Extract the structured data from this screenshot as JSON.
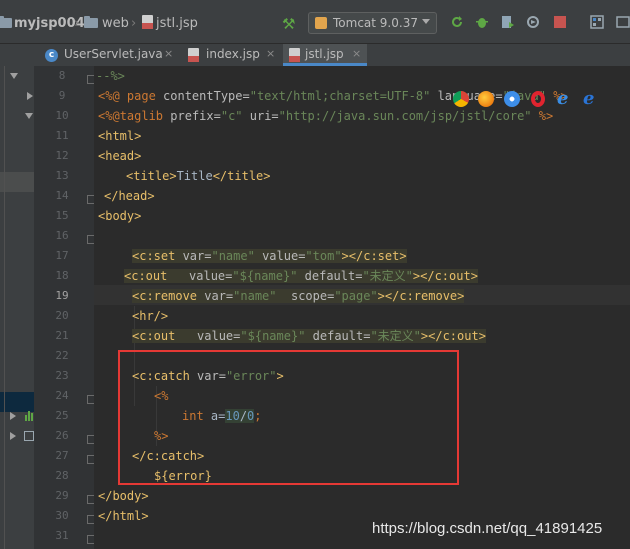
{
  "breadcrumb": {
    "project": "myjsp004",
    "folder": "web",
    "file": "jstl.jsp"
  },
  "toolbar": {
    "run_config": "Tomcat 9.0.37"
  },
  "tabs": [
    {
      "label": "UserServlet.java",
      "close": "×"
    },
    {
      "label": "index.jsp",
      "close": "×"
    },
    {
      "label": "jstl.jsp",
      "close": "×"
    }
  ],
  "editor": {
    "current_line": "19",
    "line_numbers": [
      "8",
      "9",
      "10",
      "11",
      "12",
      "13",
      "14",
      "15",
      "16",
      "17",
      "18",
      "19",
      "20",
      "21",
      "22",
      "23",
      "24",
      "25",
      "26",
      "27",
      "28",
      "29",
      "30",
      "31"
    ],
    "lines": {
      "l8_text": "--%>",
      "l9_p1": "<%@ ",
      "l9_p2": "page ",
      "l9_p3": "contentType=",
      "l9_p4": "\"text/html;charset=UTF-8\"",
      "l9_p5": " language=",
      "l9_p6": "\"java\"",
      "l9_p7": " %>",
      "l10_p1": "<%@",
      "l10_p2": "taglib ",
      "l10_p3": "prefix=",
      "l10_p4": "\"c\"",
      "l10_p5": " uri=",
      "l10_p6": "\"http://java.sun.com/jsp/jstl/core\"",
      "l10_p7": " %>",
      "l11": "<html>",
      "l12": "<head>",
      "l13_open": "<title>",
      "l13_text": "Title",
      "l13_close": "</title>",
      "l14": "</head>",
      "l15": "<body>",
      "l17_p1": "<c:set ",
      "l17_p2": "var=",
      "l17_p3": "\"name\"",
      "l17_p4": " value=",
      "l17_p5": "\"tom\"",
      "l17_p6": "></c:set>",
      "l18_p1": "<c:out   ",
      "l18_p2": "value=",
      "l18_p3": "\"${name}\"",
      "l18_p4": " default=",
      "l18_p5": "\"未定义\"",
      "l18_p6": "></c:out>",
      "l19_p1": "<c:remove ",
      "l19_p2": "var=",
      "l19_p3": "\"name\"",
      "l19_p4": "  scope=",
      "l19_p5": "\"page\"",
      "l19_p6": "></c:remove>",
      "l20": "<hr/>",
      "l21_p1": "<c:out   ",
      "l21_p2": "value=",
      "l21_p3": "\"${name}\"",
      "l21_p4": " default=",
      "l21_p5": "\"未定义\"",
      "l21_p6": "></c:out>",
      "l23_p1": "<c:catch ",
      "l23_p2": "var=",
      "l23_p3": "\"error\"",
      "l23_p4": ">",
      "l24": "<%",
      "l25_p1": "int ",
      "l25_p2": "a=",
      "l25_p3": "10",
      "l25_p4": "/",
      "l25_p5": "0",
      "l25_p6": ";",
      "l26": "%>",
      "l27": "</c:catch>",
      "l28": "${error}",
      "l29": "</body>",
      "l30": "</html>"
    }
  },
  "colors": {
    "keyword": "#cc7832",
    "tag": "#e8bf6a",
    "string": "#6a8759",
    "number": "#6897bb",
    "highlight_box": "#e53935"
  },
  "watermark": "https://blog.csdn.net/qq_41891425"
}
